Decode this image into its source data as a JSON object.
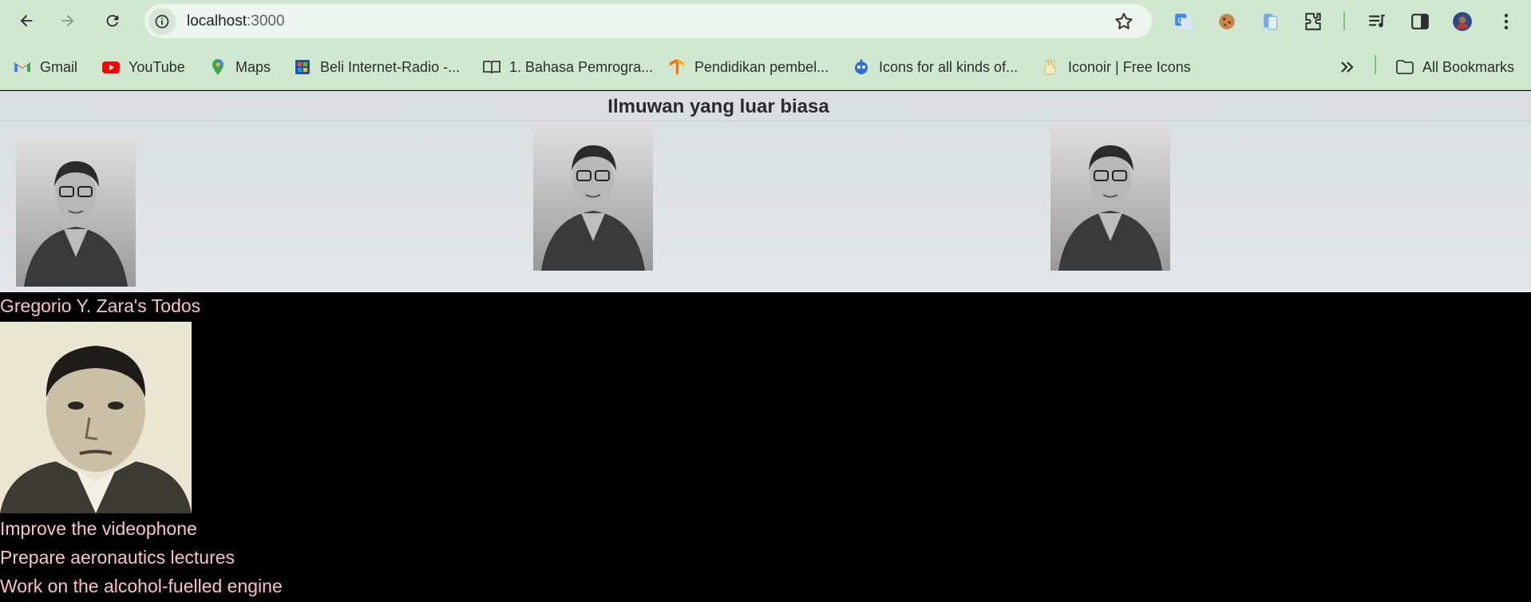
{
  "browser": {
    "url_host": "localhost",
    "url_port": ":3000",
    "bookmarks": [
      {
        "label": "Gmail",
        "icon": "gmail-icon"
      },
      {
        "label": "YouTube",
        "icon": "youtube-icon"
      },
      {
        "label": "Maps",
        "icon": "maps-icon"
      },
      {
        "label": "Beli Internet-Radio -...",
        "icon": "radio-store-icon"
      },
      {
        "label": "1. Bahasa Pemrogra...",
        "icon": "book-icon"
      },
      {
        "label": "Pendidikan pembel...",
        "icon": "tensorflow-icon"
      },
      {
        "label": "Icons for all kinds of...",
        "icon": "robot-icon"
      },
      {
        "label": "Iconoir | Free Icons",
        "icon": "peace-hand-icon"
      }
    ],
    "all_bookmarks_label": "All Bookmarks",
    "colors": {
      "chrome": "#cfe8cf",
      "omnibox": "#eef5ee"
    }
  },
  "page": {
    "title": "Ilmuwan yang luar biasa",
    "todos_heading": "Gregorio Y. Zara's Todos",
    "todos": [
      "Improve the videophone",
      "Prepare aeronautics lectures",
      "Work on the alcohol-fuelled engine"
    ],
    "colors": {
      "todo_text": "#f7c2cb",
      "dark_bg": "#000000"
    }
  }
}
